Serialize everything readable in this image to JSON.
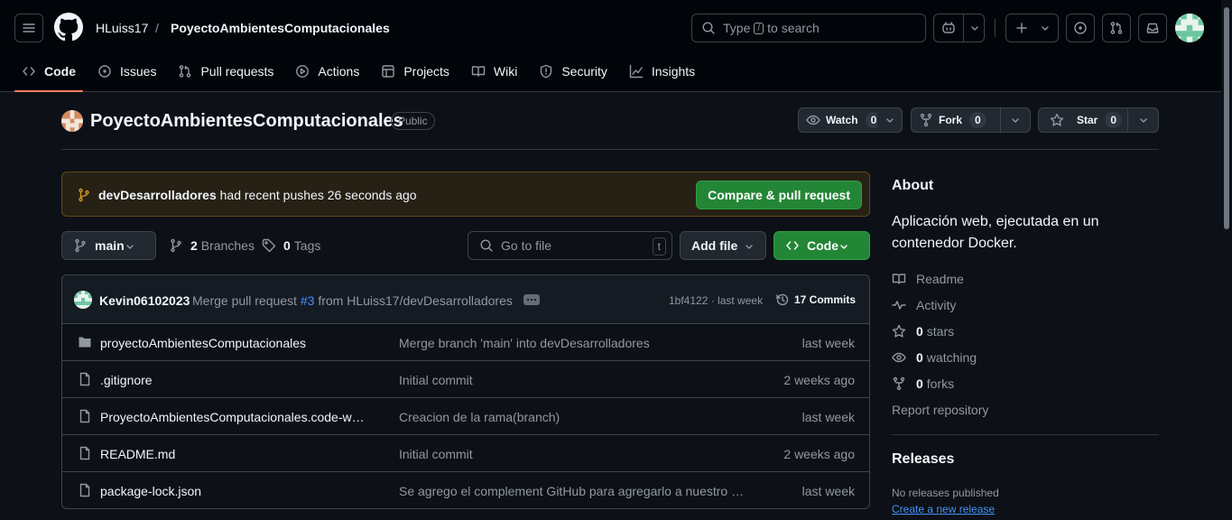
{
  "header": {
    "owner": "HLuiss17",
    "separator": "/",
    "repo": "PoyectoAmbientesComputacionales",
    "search_pre": "Type",
    "search_key": "/",
    "search_post": "to search"
  },
  "tabs": [
    {
      "label": "Code",
      "icon": "code-icon"
    },
    {
      "label": "Issues",
      "icon": "issue-icon"
    },
    {
      "label": "Pull requests",
      "icon": "pull-request-icon"
    },
    {
      "label": "Actions",
      "icon": "play-icon"
    },
    {
      "label": "Projects",
      "icon": "table-icon"
    },
    {
      "label": "Wiki",
      "icon": "book-icon"
    },
    {
      "label": "Security",
      "icon": "shield-icon"
    },
    {
      "label": "Insights",
      "icon": "graph-icon"
    }
  ],
  "repo": {
    "title": "PoyectoAmbientesComputacionales",
    "visibility": "Public",
    "watch_label": "Watch",
    "watch_count": "0",
    "fork_label": "Fork",
    "fork_count": "0",
    "star_label": "Star",
    "star_count": "0"
  },
  "banner": {
    "branch": "devDesarrolladores",
    "text": "had recent pushes 26 seconds ago",
    "button": "Compare & pull request"
  },
  "filenav": {
    "branch": "main",
    "branches_count": "2",
    "branches_label": "Branches",
    "tags_count": "0",
    "tags_label": "Tags",
    "goto_placeholder": "Go to file",
    "goto_key": "t",
    "add_file": "Add file",
    "code": "Code"
  },
  "commit": {
    "author": "Kevin06102023",
    "msg_pre": "Merge pull request",
    "pr": "#3",
    "msg_post": "from HLuiss17/devDesarrolladores",
    "hash_time": "1bf4122 · last week",
    "commits": "17 Commits"
  },
  "files": [
    {
      "type": "dir",
      "name": "proyectoAmbientesComputacionales",
      "message": "Merge branch 'main' into devDesarrolladores",
      "date": "last week"
    },
    {
      "type": "file",
      "name": ".gitignore",
      "message": "Initial commit",
      "date": "2 weeks ago"
    },
    {
      "type": "file",
      "name": "ProyectoAmbientesComputacionales.code-wor...",
      "message": "Creacion de la rama(branch)",
      "date": "last week"
    },
    {
      "type": "file",
      "name": "README.md",
      "message": "Initial commit",
      "date": "2 weeks ago"
    },
    {
      "type": "file",
      "name": "package-lock.json",
      "message": "Se agrego el complement GitHub para agregarlo a nuestro a...",
      "date": "last week"
    }
  ],
  "about": {
    "heading": "About",
    "description": "Aplicación web, ejecutada en un contenedor Docker.",
    "readme": "Readme",
    "activity": "Activity",
    "stars_count": "0",
    "stars_label": "stars",
    "watching_count": "0",
    "watching_label": "watching",
    "forks_count": "0",
    "forks_label": "forks",
    "report": "Report repository"
  },
  "releases": {
    "heading": "Releases",
    "none": "No releases published",
    "create": "Create a new release"
  },
  "colors": {
    "background": "#0d1117",
    "header": "#010409",
    "accent_green": "#238636",
    "link_blue": "#4493f8",
    "tab_underline": "#f78166",
    "banner_bg": "#272115"
  }
}
